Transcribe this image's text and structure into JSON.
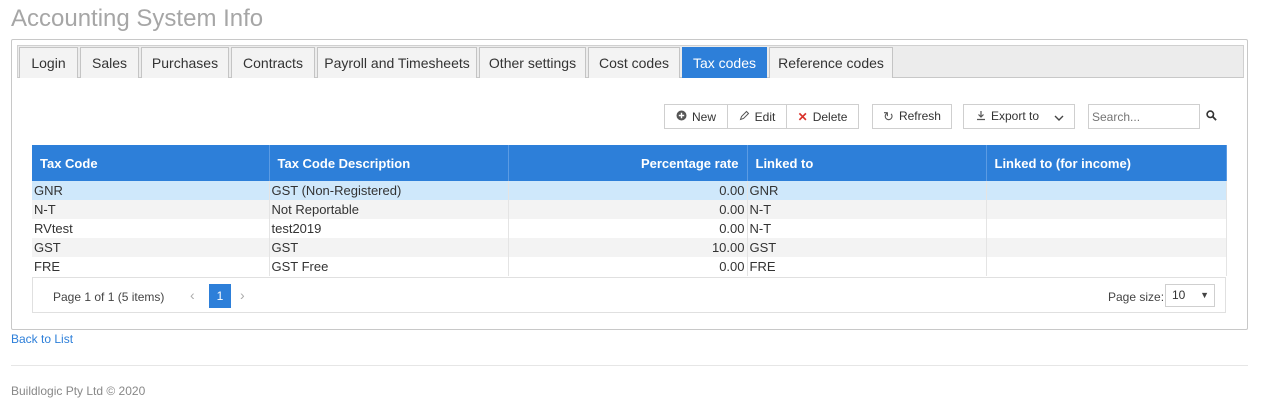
{
  "page": {
    "title": "Accounting System Info"
  },
  "tabs": [
    {
      "label": "Login"
    },
    {
      "label": "Sales"
    },
    {
      "label": "Purchases"
    },
    {
      "label": "Contracts"
    },
    {
      "label": "Payroll and Timesheets"
    },
    {
      "label": "Other settings"
    },
    {
      "label": "Cost codes"
    },
    {
      "label": "Tax codes",
      "active": true
    },
    {
      "label": "Reference codes"
    }
  ],
  "toolbar": {
    "new_label": "New",
    "edit_label": "Edit",
    "delete_label": "Delete",
    "refresh_label": "Refresh",
    "export_label": "Export to",
    "search_placeholder": "Search..."
  },
  "grid": {
    "columns": [
      "Tax Code",
      "Tax Code Description",
      "Percentage rate",
      "Linked to",
      "Linked to (for income)"
    ],
    "rows": [
      {
        "code": "GNR",
        "description": "GST (Non-Registered)",
        "rate": "0.00",
        "linked": "GNR",
        "linked_income": ""
      },
      {
        "code": "N-T",
        "description": "Not Reportable",
        "rate": "0.00",
        "linked": "N-T",
        "linked_income": ""
      },
      {
        "code": "RVtest",
        "description": "test2019",
        "rate": "0.00",
        "linked": "N-T",
        "linked_income": ""
      },
      {
        "code": "GST",
        "description": "GST",
        "rate": "10.00",
        "linked": "GST",
        "linked_income": ""
      },
      {
        "code": "FRE",
        "description": "GST Free",
        "rate": "0.00",
        "linked": "FRE",
        "linked_income": ""
      }
    ]
  },
  "pager": {
    "summary": "Page 1 of 1 (5 items)",
    "current_page": "1",
    "page_size_label": "Page size:",
    "page_size_value": "10"
  },
  "back_link": "Back to List",
  "footer": "Buildlogic Pty Ltd © 2020",
  "colors": {
    "accent": "#2d7fd9",
    "selected_row": "#cfe8fb",
    "delete_icon": "#d9322b"
  }
}
